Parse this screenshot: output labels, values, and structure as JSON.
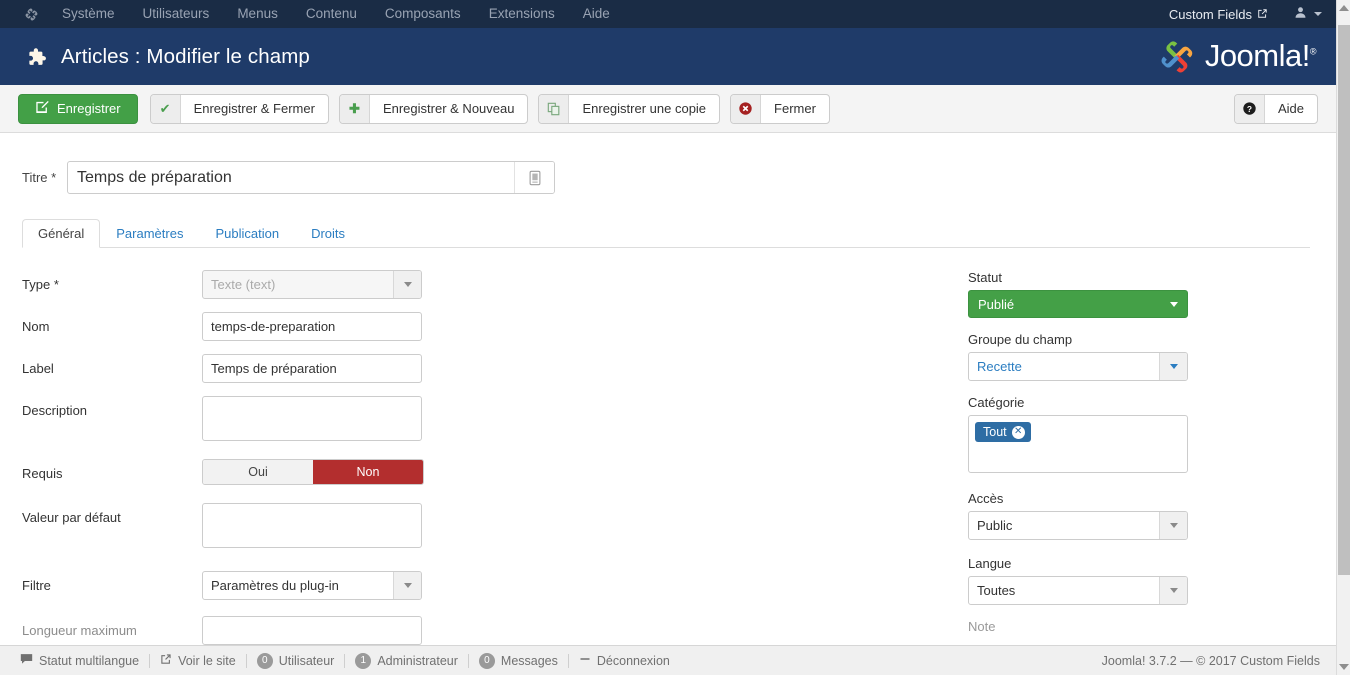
{
  "topnav": {
    "brand_icon": "joomla-mark-icon",
    "items": [
      {
        "label": "Système"
      },
      {
        "label": "Utilisateurs"
      },
      {
        "label": "Menus"
      },
      {
        "label": "Contenu"
      },
      {
        "label": "Composants"
      },
      {
        "label": "Extensions"
      },
      {
        "label": "Aide"
      }
    ],
    "site_name": "Custom Fields",
    "site_icon": "external-link-icon",
    "user_icon": "user-icon"
  },
  "subhead": {
    "icon": "puzzle-piece-icon",
    "title": "Articles : Modifier le champ",
    "logo_text": "Joomla!",
    "logo_sup": "®"
  },
  "toolbar": {
    "save": {
      "label": "Enregistrer",
      "icon": "edit-pencil-icon"
    },
    "save_close": {
      "label": "Enregistrer & Fermer",
      "icon": "check-icon"
    },
    "save_new": {
      "label": "Enregistrer & Nouveau",
      "icon": "plus-icon"
    },
    "save_copy": {
      "label": "Enregistrer une copie",
      "icon": "copy-icon"
    },
    "close": {
      "label": "Fermer",
      "icon": "close-circle-icon"
    },
    "help": {
      "label": "Aide",
      "icon": "question-circle-icon"
    }
  },
  "title_field": {
    "label": "Titre",
    "required_mark": "*",
    "value": "Temps de préparation",
    "addon_icon": "book-icon"
  },
  "tabs": [
    {
      "label": "Général",
      "active": true
    },
    {
      "label": "Paramètres",
      "active": false
    },
    {
      "label": "Publication",
      "active": false
    },
    {
      "label": "Droits",
      "active": false
    }
  ],
  "form": {
    "type": {
      "label": "Type",
      "required_mark": "*",
      "value": "Texte (text)",
      "disabled": true
    },
    "nom": {
      "label": "Nom",
      "value": "temps-de-preparation"
    },
    "label_field": {
      "label": "Label",
      "value": "Temps de préparation"
    },
    "description": {
      "label": "Description",
      "value": ""
    },
    "requis": {
      "label": "Requis",
      "option_yes": "Oui",
      "option_no": "Non",
      "selected": "Non"
    },
    "default_value": {
      "label": "Valeur par défaut",
      "value": ""
    },
    "filtre": {
      "label": "Filtre",
      "value": "Paramètres du plug-in"
    },
    "max_length": {
      "label": "Longueur maximum",
      "value": ""
    }
  },
  "sidebar": {
    "statut": {
      "label": "Statut",
      "value": "Publié",
      "color": "#44a047"
    },
    "groupe": {
      "label": "Groupe du champ",
      "value": "Recette"
    },
    "categorie": {
      "label": "Catégorie",
      "chip": "Tout",
      "chip_remove_icon": "remove-circle-icon"
    },
    "acces": {
      "label": "Accès",
      "value": "Public"
    },
    "langue": {
      "label": "Langue",
      "value": "Toutes"
    },
    "note": {
      "label": "Note"
    }
  },
  "statusbar": {
    "items": [
      {
        "icon": "comment-icon",
        "label": "Statut multilangue",
        "badge": null
      },
      {
        "icon": "external-link-icon",
        "label": "Voir le site",
        "badge": null
      },
      {
        "icon": null,
        "label": "Utilisateur",
        "badge": "0"
      },
      {
        "icon": null,
        "label": "Administrateur",
        "badge": "1"
      },
      {
        "icon": null,
        "label": "Messages",
        "badge": "0"
      },
      {
        "icon": "minus-icon",
        "label": "Déconnexion",
        "badge": null
      }
    ],
    "copyright": "Joomla! 3.7.2  —  © 2017 Custom Fields"
  }
}
